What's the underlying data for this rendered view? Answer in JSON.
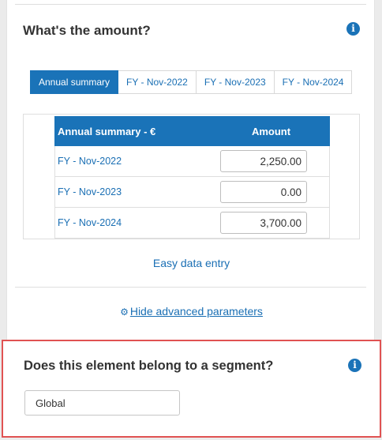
{
  "amount_section": {
    "title": "What's the amount?",
    "info_icon": "info-icon",
    "tabs": [
      {
        "label": "Annual summary",
        "active": true
      },
      {
        "label": "FY - Nov-2022",
        "active": false
      },
      {
        "label": "FY - Nov-2023",
        "active": false
      },
      {
        "label": "FY - Nov-2024",
        "active": false
      }
    ],
    "table": {
      "headers": [
        "Annual summary - €",
        "Amount"
      ],
      "rows": [
        {
          "label": "FY - Nov-2022",
          "amount": "2,250.00"
        },
        {
          "label": "FY - Nov-2023",
          "amount": "0.00"
        },
        {
          "label": "FY - Nov-2024",
          "amount": "3,700.00"
        }
      ]
    },
    "easy_data_entry": "Easy data entry",
    "hide_advanced": "Hide advanced parameters",
    "gear_icon": "gear-icon"
  },
  "segment_section": {
    "title": "Does this element belong to a segment?",
    "info_icon": "info-icon",
    "value": "Global",
    "highlight_color": "#e05252"
  },
  "colors": {
    "accent": "#1a73b8",
    "link": "#1a6fb4"
  }
}
